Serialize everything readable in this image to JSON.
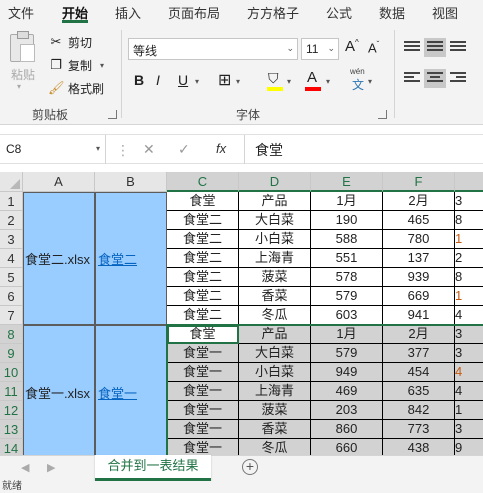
{
  "ribbon_tabs": [
    "文件",
    "开始",
    "插入",
    "页面布局",
    "方方格子",
    "公式",
    "数据",
    "视图"
  ],
  "active_tab": "开始",
  "clipboard": {
    "paste": "粘贴",
    "cut": "剪切",
    "copy": "复制",
    "format_painter": "格式刷",
    "group_label": "剪贴板"
  },
  "font": {
    "name": "等线",
    "size": "11",
    "group_label": "字体",
    "bold": "B",
    "italic": "I",
    "underline": "U",
    "grow": "A",
    "shrink": "A",
    "wen": "wén",
    "wen_char": "文",
    "fill_color": "#ffff00",
    "font_color": "#ff0000"
  },
  "formula_bar": {
    "name_box": "C8",
    "fx": "fx",
    "value": "食堂"
  },
  "columns": [
    "A",
    "B",
    "C",
    "D",
    "E",
    "F",
    ""
  ],
  "rows": [
    "1",
    "2",
    "3",
    "4",
    "5",
    "6",
    "7",
    "8",
    "9",
    "10",
    "11",
    "12",
    "13",
    "14"
  ],
  "selected_column_headers": [
    "C",
    "D",
    "E",
    "F"
  ],
  "merged_blocks": [
    {
      "file": "食堂二.xlsx",
      "link": "食堂二"
    },
    {
      "file": "食堂一.xlsx",
      "link": "食堂一"
    }
  ],
  "table": [
    [
      "食堂",
      "产品",
      "1月",
      "2月",
      "3"
    ],
    [
      "食堂二",
      "大白菜",
      "190",
      "465",
      "8"
    ],
    [
      "食堂二",
      "小白菜",
      "588",
      "780",
      "1"
    ],
    [
      "食堂二",
      "上海青",
      "551",
      "137",
      "2"
    ],
    [
      "食堂二",
      "菠菜",
      "578",
      "939",
      "8"
    ],
    [
      "食堂二",
      "香菜",
      "579",
      "669",
      "1"
    ],
    [
      "食堂二",
      "冬瓜",
      "603",
      "941",
      "4"
    ],
    [
      "食堂",
      "产品",
      "1月",
      "2月",
      "3"
    ],
    [
      "食堂一",
      "大白菜",
      "579",
      "377",
      "3"
    ],
    [
      "食堂一",
      "小白菜",
      "949",
      "454",
      "4"
    ],
    [
      "食堂一",
      "上海青",
      "469",
      "635",
      "4"
    ],
    [
      "食堂一",
      "菠菜",
      "203",
      "842",
      "1"
    ],
    [
      "食堂一",
      "香菜",
      "860",
      "773",
      "3"
    ],
    [
      "食堂一",
      "冬瓜",
      "660",
      "438",
      "9"
    ]
  ],
  "sheet_tab": "合并到一表结果",
  "status": "就绪"
}
